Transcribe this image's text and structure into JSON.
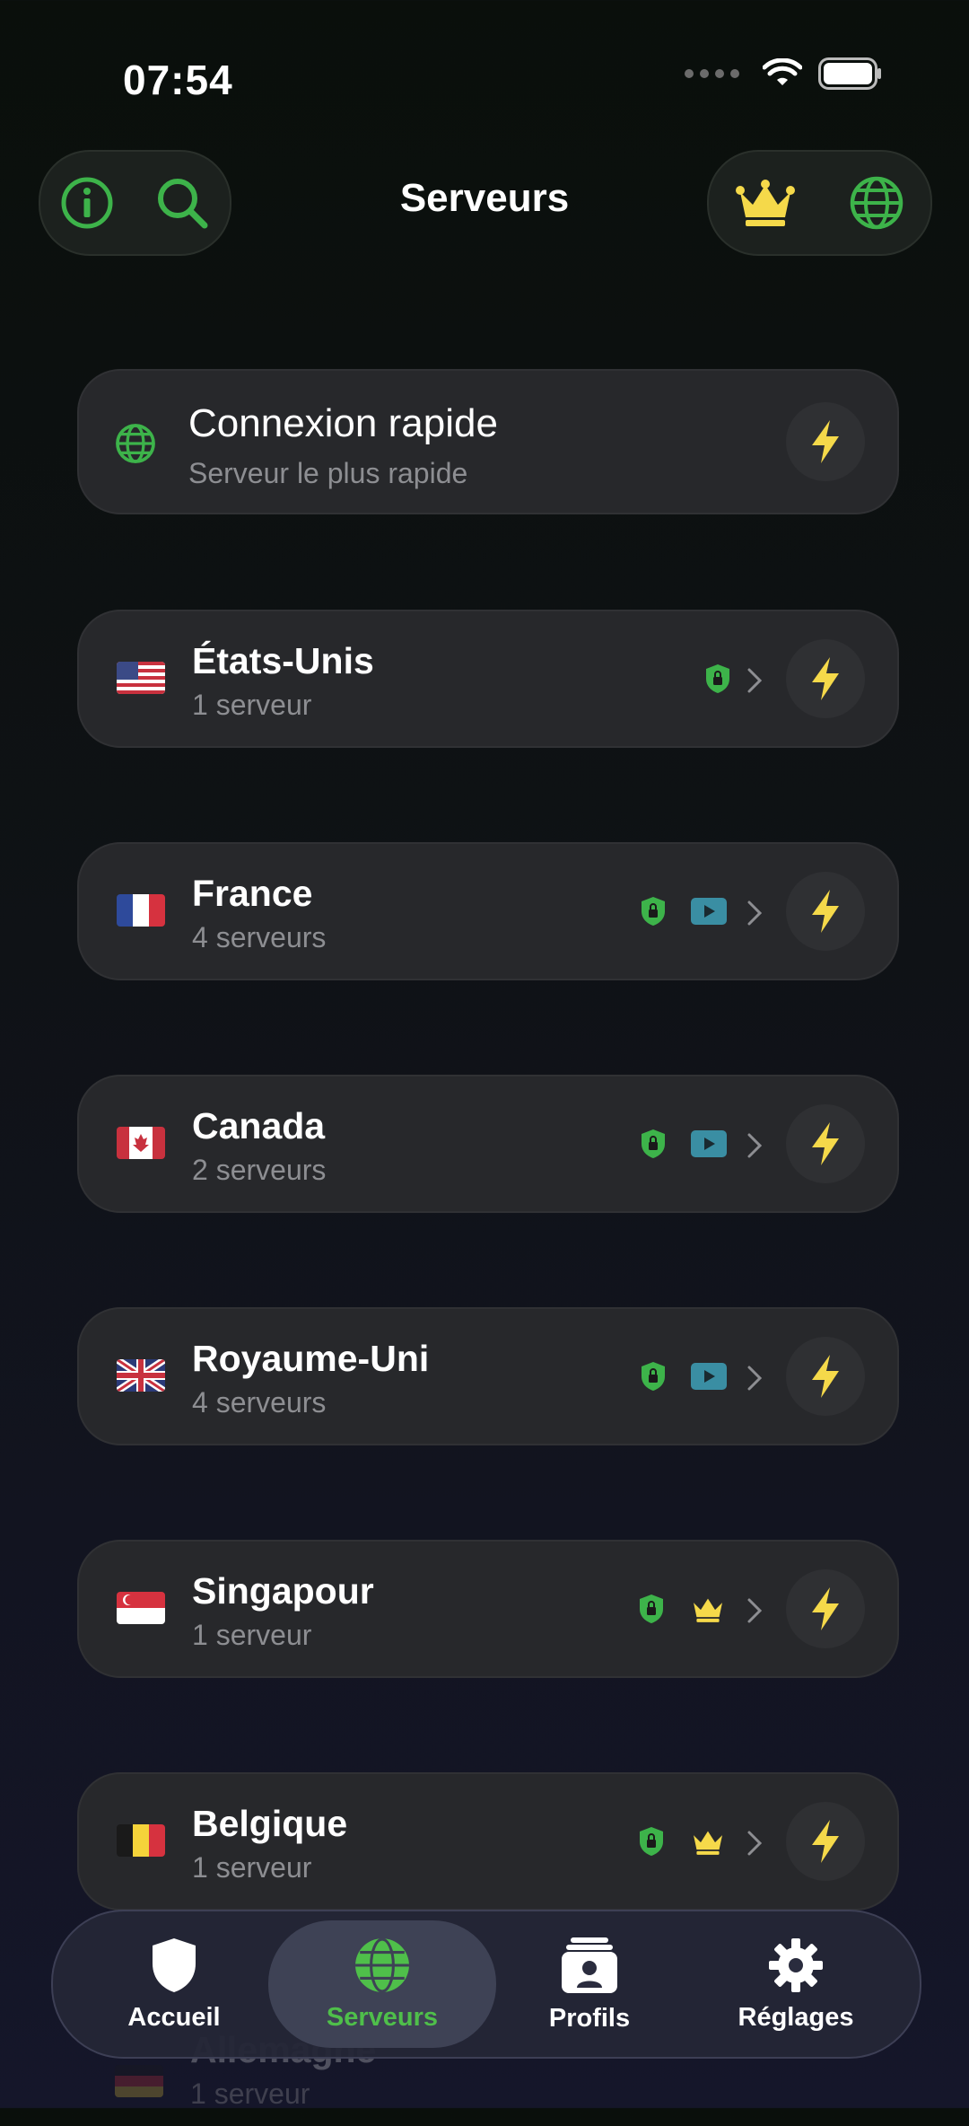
{
  "status": {
    "time": "07:54"
  },
  "header": {
    "title": "Serveurs"
  },
  "quick": {
    "title": "Connexion rapide",
    "subtitle": "Serveur le plus rapide"
  },
  "servers": [
    {
      "name": "États-Unis",
      "count": "1 serveur"
    },
    {
      "name": "France",
      "count": "4 serveurs"
    },
    {
      "name": "Canada",
      "count": "2 serveurs"
    },
    {
      "name": "Royaume-Uni",
      "count": "4 serveurs"
    },
    {
      "name": "Singapour",
      "count": "1 serveur"
    },
    {
      "name": "Belgique",
      "count": "1 serveur"
    },
    {
      "name": "Allemagne",
      "count": "1 serveur"
    }
  ],
  "tabs": [
    {
      "label": "Accueil"
    },
    {
      "label": "Serveurs"
    },
    {
      "label": "Profils"
    },
    {
      "label": "Réglages"
    }
  ],
  "colors": {
    "green": "#3db34a",
    "yellow": "#f5d94a",
    "teal": "#3a8ea3",
    "active_tab": "#4fbf4a"
  }
}
